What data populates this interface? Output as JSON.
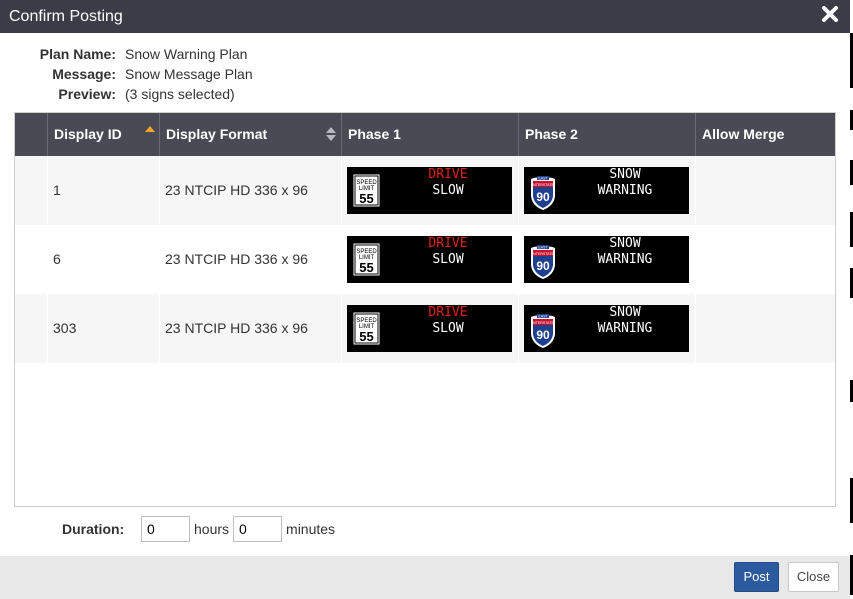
{
  "dialog": {
    "title": "Confirm Posting",
    "close_icon": "close-icon"
  },
  "info": {
    "plan_name_label": "Plan Name:",
    "plan_name": "Snow Warning Plan",
    "message_label": "Message:",
    "message": "Snow Message Plan",
    "preview_label": "Preview:",
    "preview": "(3 signs selected)"
  },
  "table": {
    "columns": [
      "Display ID",
      "Display Format",
      "Phase 1",
      "Phase 2",
      "Allow Merge"
    ],
    "rows": [
      {
        "display_id": "1",
        "display_format": "23 NTCIP HD 336 x 96"
      },
      {
        "display_id": "6",
        "display_format": "23 NTCIP HD 336 x 96"
      },
      {
        "display_id": "303",
        "display_format": "23 NTCIP HD 336 x 96"
      }
    ],
    "phase1": {
      "speed_sign_top": "SPEED",
      "speed_sign_mid": "LIMIT",
      "speed_value": "55",
      "line1": "DRIVE",
      "line2": "SLOW"
    },
    "phase2": {
      "shield_top": "EAST",
      "shield_mid": "INTERSTATE",
      "shield_number": "90",
      "line1": "SNOW",
      "line2": "WARNING"
    }
  },
  "duration": {
    "label": "Duration:",
    "hours_value": "0",
    "hours_unit": "hours",
    "minutes_value": "0",
    "minutes_unit": "minutes"
  },
  "buttons": {
    "post": "Post",
    "close": "Close"
  },
  "colors": {
    "header": "#4a4a54",
    "titlebar": "#3c3c48",
    "accent": "#2b5a9e",
    "sort_active": "#f5a623",
    "sign_red": "#e0201a"
  }
}
